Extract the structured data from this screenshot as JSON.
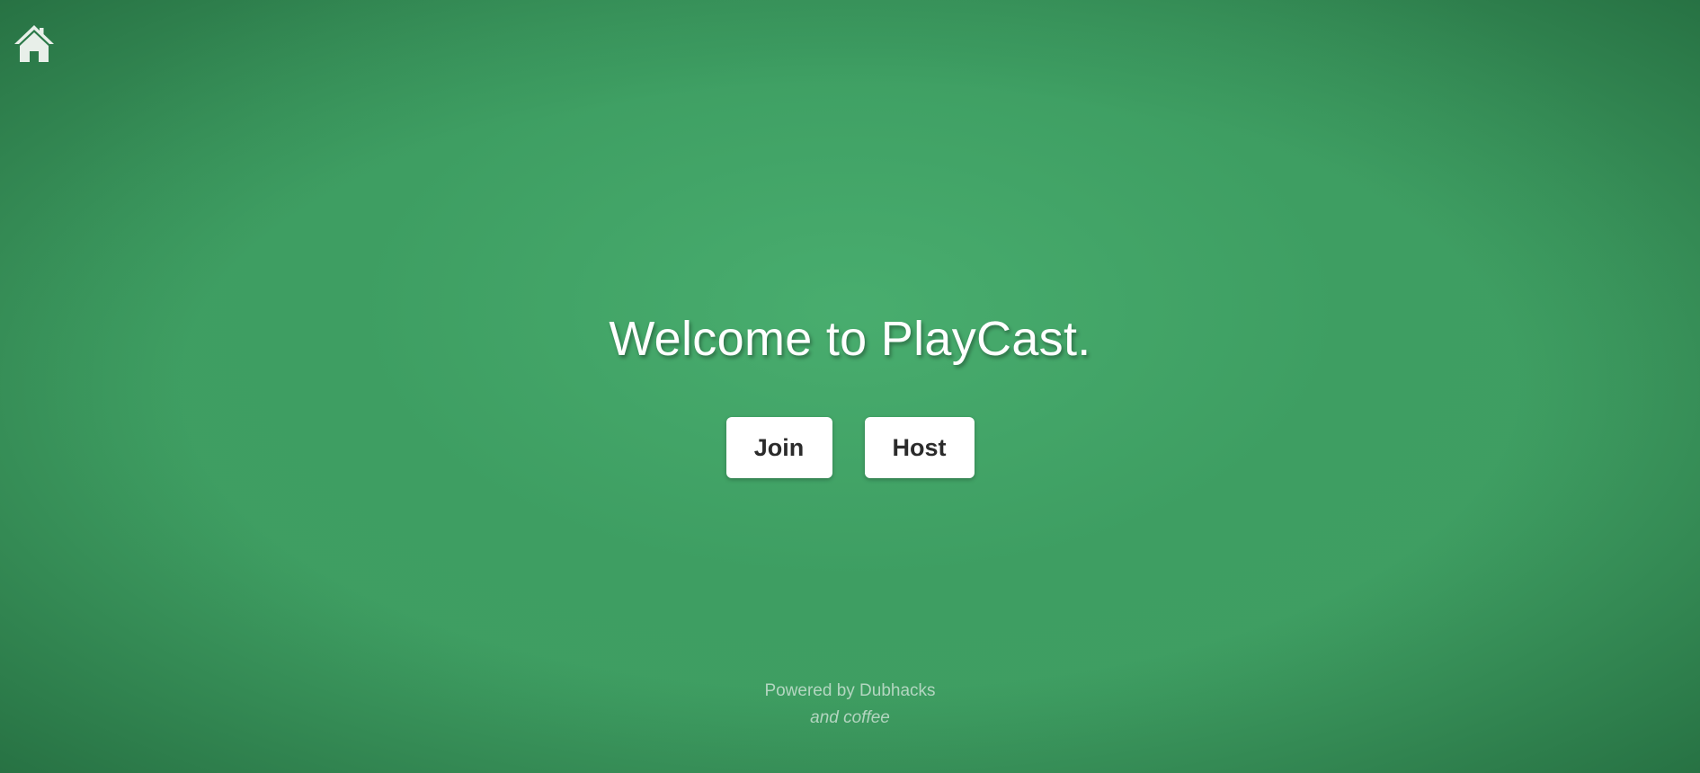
{
  "nav": {
    "home_icon": "home-icon"
  },
  "main": {
    "title": "Welcome to PlayCast.",
    "join_label": "Join",
    "host_label": "Host"
  },
  "footer": {
    "line1": "Powered by Dubhacks",
    "line2": "and coffee"
  },
  "colors": {
    "background": "#3f9e62",
    "button_bg": "#ffffff",
    "button_text": "#2b2b2b",
    "title_text": "#ffffff"
  }
}
